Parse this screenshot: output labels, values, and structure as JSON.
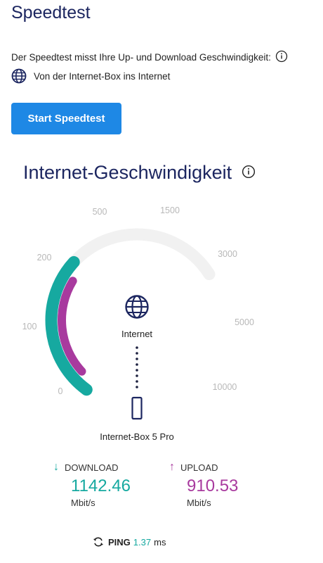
{
  "header": {
    "title": "Speedtest"
  },
  "intro": {
    "description": "Der Speedtest misst Ihre Up- und Download Geschwindigkeit:",
    "route": "Von der Internet-Box ins Internet"
  },
  "actions": {
    "start_label": "Start Speedtest"
  },
  "gauge": {
    "title": "Internet-Geschwindigkeit",
    "ticks": [
      "0",
      "100",
      "200",
      "500",
      "1500",
      "3000",
      "5000",
      "10000"
    ],
    "download_fraction": 0.345,
    "upload_fraction": 0.305,
    "node_top_label": "Internet",
    "node_bottom_label": "Internet-Box 5 Pro",
    "colors": {
      "download": "#16a9a0",
      "upload": "#a83a9e",
      "track": "#f1f1f1"
    }
  },
  "download": {
    "label": "DOWNLOAD",
    "value": "1142.46",
    "unit": "Mbit/s"
  },
  "upload": {
    "label": "UPLOAD",
    "value": "910.53",
    "unit": "Mbit/s"
  },
  "ping": {
    "label": "PING",
    "value": "1.37",
    "unit": "ms"
  }
}
